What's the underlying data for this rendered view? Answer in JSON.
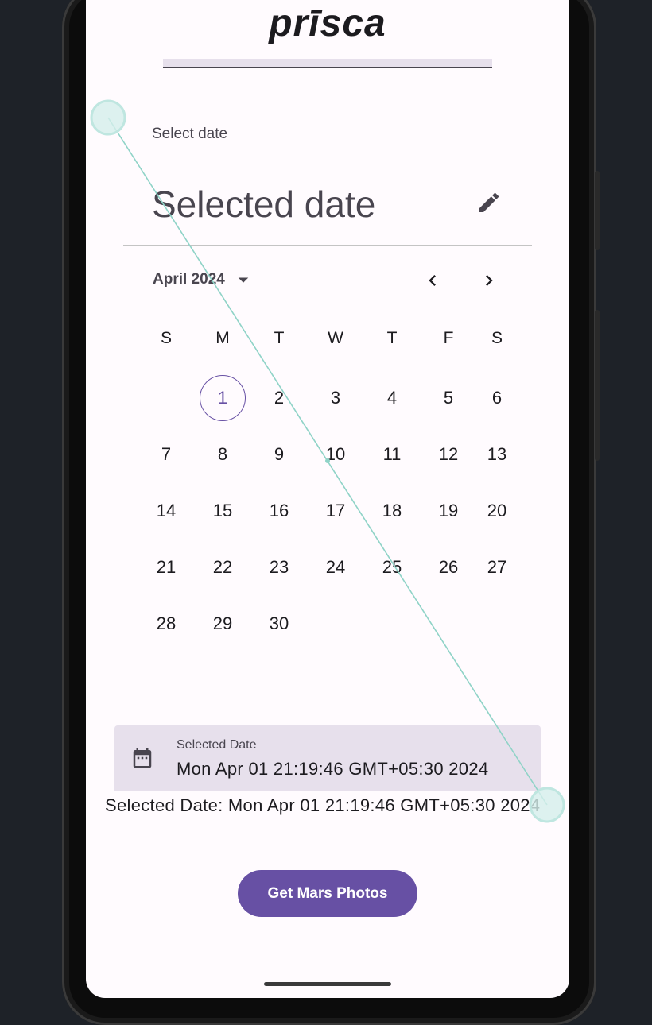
{
  "app": {
    "title": "prīsca"
  },
  "date_picker": {
    "title": "Select date",
    "headline": "Selected date",
    "edit_icon": "pencil-icon",
    "month_year": "April 2024",
    "month_dropdown_icon": "dropdown-arrow-icon",
    "prev_icon": "chevron-left-icon",
    "next_icon": "chevron-right-icon",
    "weekdays": [
      "S",
      "M",
      "T",
      "W",
      "T",
      "F",
      "S"
    ],
    "first_weekday_index": 1,
    "days": [
      "1",
      "2",
      "3",
      "4",
      "5",
      "6",
      "7",
      "8",
      "9",
      "10",
      "11",
      "12",
      "13",
      "14",
      "15",
      "16",
      "17",
      "18",
      "19",
      "20",
      "21",
      "22",
      "23",
      "24",
      "25",
      "26",
      "27",
      "28",
      "29",
      "30"
    ],
    "today": "1"
  },
  "date_field": {
    "icon": "calendar-icon",
    "label": "Selected Date",
    "value": "Mon Apr 01 21:19:46 GMT+05:30 2024"
  },
  "result": {
    "text": "Selected Date: Mon Apr 01 21:19:46 GMT+05:30 2024"
  },
  "button": {
    "label": "Get Mars Photos"
  },
  "colors": {
    "primary": "#6750a4",
    "surface": "#fffbfe",
    "field_background": "#e7e0ec",
    "on_surface": "#1c1b1f",
    "on_surface_variant": "#49454f",
    "device_background": "#1e2228",
    "gesture_trace": "#8fd3c7"
  },
  "gesture": {
    "type": "swipe"
  }
}
